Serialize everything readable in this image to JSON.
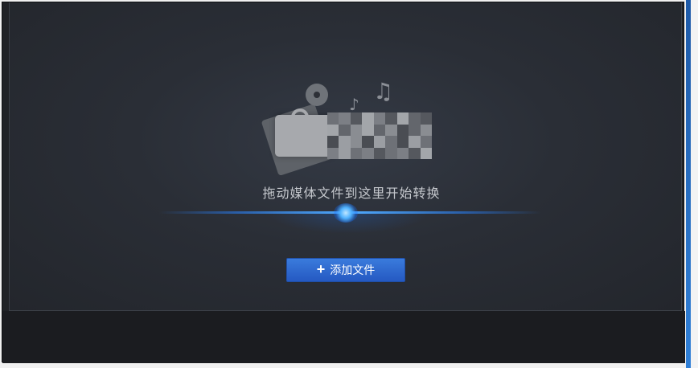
{
  "drop_area": {
    "hint": "拖动媒体文件到这里开始转换"
  },
  "actions": {
    "add_files_label": "添加文件",
    "add_icon_glyph": "+"
  },
  "illustration": {
    "icons": [
      "music-note-icon",
      "film-reel-icon",
      "film-strip-icon",
      "lock-icon"
    ],
    "music_glyph": "♫",
    "small_note_glyph": "♪"
  },
  "colors": {
    "background": "#202226",
    "panel": "#2a2e36",
    "accent_blue": "#2f6ad1",
    "glow": "#4fb2ff",
    "hint_text": "#c5c8cd"
  }
}
